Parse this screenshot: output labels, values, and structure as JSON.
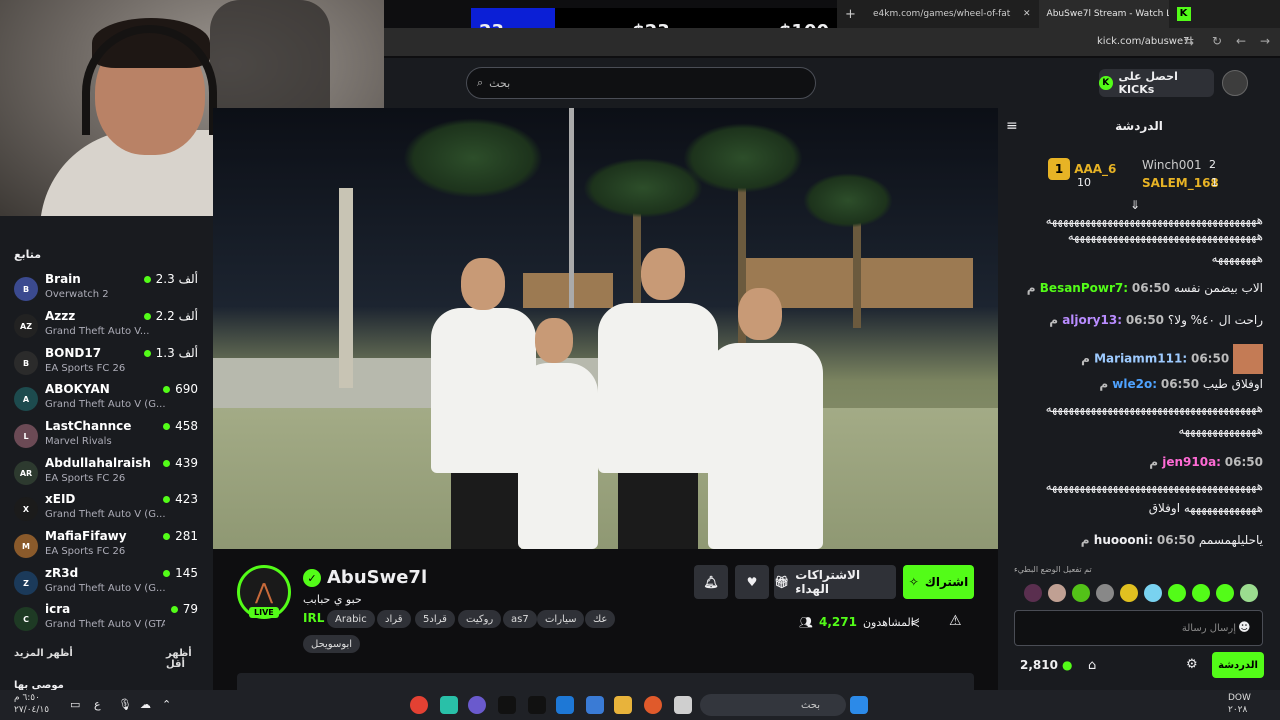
{
  "overlay": {
    "wheel": {
      "left": "23",
      "middle": "$23",
      "right": "$100"
    }
  },
  "browser": {
    "tabs": [
      "e4km.com/games/wheel-of-fat",
      "AbuSwe7l Stream - Watch L"
    ],
    "new_tab": "+",
    "url": "kick.com/abuswe7l"
  },
  "header": {
    "search_placeholder": "بحث",
    "get_kicks": "احصل على KICKs"
  },
  "sidebar": {
    "title": "متابع",
    "channels": [
      {
        "name": "Brain",
        "game": "Overwatch 2",
        "viewers": "2.3 ألف",
        "color": "#3b4a8f",
        "initial": "B"
      },
      {
        "name": "Azzz",
        "game": "Grand Theft Auto V...",
        "viewers": "2.2 ألف",
        "color": "#222222",
        "initial": "AZ"
      },
      {
        "name": "BOND17",
        "game": "EA Sports FC 26",
        "viewers": "1.3 ألف",
        "color": "#2b2b2b",
        "initial": "B"
      },
      {
        "name": "ABOKYAN",
        "game": "Grand Theft Auto V (G...",
        "viewers": "690",
        "color": "#1d4b4e",
        "initial": "A"
      },
      {
        "name": "LastChannce",
        "game": "Marvel Rivals",
        "viewers": "458",
        "color": "#6b4a55",
        "initial": "L"
      },
      {
        "name": "Abdullahalraish",
        "game": "EA Sports FC 26",
        "viewers": "439",
        "color": "#2d3a2f",
        "initial": "AR"
      },
      {
        "name": "xEID",
        "game": "Grand Theft Auto V (G...",
        "viewers": "423",
        "color": "#1b1b1b",
        "initial": "X"
      },
      {
        "name": "MafiaFifawy",
        "game": "EA Sports FC 26",
        "viewers": "281",
        "color": "#8a5a2b",
        "initial": "M"
      },
      {
        "name": "zR3d",
        "game": "Grand Theft Auto V (G...",
        "viewers": "145",
        "color": "#1b3a5a",
        "initial": "Z"
      },
      {
        "name": "icra",
        "game": "Grand Theft Auto V (GTA)",
        "viewers": "79",
        "color": "#1e3a24",
        "initial": "C"
      }
    ],
    "show_more": "أظهر المزيد",
    "show_less": "أظهر أقل",
    "recommended": "موصى بها"
  },
  "channel": {
    "name": "AbuSwe7l",
    "live": "LIVE",
    "title": "حبو ي حبابب",
    "category": "IRL",
    "tags": [
      "Arabic",
      "قراد",
      "قراد5",
      "روكيت",
      "as7",
      "سيارات",
      "عك",
      "ابوسويحل"
    ],
    "subscribe": "اشتراك",
    "gift_subs": "الاشتراكات الهداء",
    "viewers_label": "المشاهدون",
    "viewers": "4,271"
  },
  "chat": {
    "title": "الدردشة",
    "leaderboard": [
      {
        "name": "AAA_6",
        "count": "10",
        "rank": "1"
      },
      {
        "name": "Winch001",
        "count": "2",
        "rank": "2"
      },
      {
        "name": "SALEM_168",
        "count": "1",
        "rank": "3"
      }
    ],
    "messages": [
      {
        "time": "",
        "user": "",
        "text": "ههههههههههههههههههههههههههههههههههههههه",
        "color": "#ffffff"
      },
      {
        "time": "",
        "user": "",
        "text": "ههههههههههههههههههههههههههههههههههه",
        "color": "#ffffff"
      },
      {
        "time": "",
        "user": "",
        "text": "ههههههههه",
        "color": "#ffffff"
      },
      {
        "time": "06:50 م",
        "user": "BesanPowr7:",
        "text": "الاب بيضمن نفسه",
        "color": "#53fc18"
      },
      {
        "time": "06:50 م",
        "user": "aljory13:",
        "text": "راحت ال ٤٠% ولا؟",
        "color": "#b98cff"
      },
      {
        "time": "06:50 م",
        "user": "Mariamm111:",
        "text": "",
        "color": "#9ecbff"
      },
      {
        "time": "06:50 م",
        "user": "wle2o:",
        "text": "اوفلاق طيب",
        "color": "#4fa3ff"
      },
      {
        "time": "",
        "user": "",
        "text": "ههههههههههههههههههههههههههههههههههههههه",
        "color": "#ffffff"
      },
      {
        "time": "",
        "user": "",
        "text": "ههههههههههههههه",
        "color": "#ffffff"
      },
      {
        "time": "06:50 م",
        "user": "jen910a:",
        "text": "",
        "color": "#ff6bd5"
      },
      {
        "time": "",
        "user": "",
        "text": "ههههههههههههههههههههههههههههههههههههههه",
        "color": "#ffffff"
      },
      {
        "time": "",
        "user": "",
        "text": "هههههههههههههه اوفلاق",
        "color": "#ffffff"
      },
      {
        "time": "06:50 م",
        "user": "huoooni:",
        "text": "ياحليلهمسمم",
        "color": "#ffffff"
      }
    ],
    "paused_note": "تم تفعيل الوضع البطيء",
    "input_placeholder": "إرسال رسالة",
    "send": "الدردشة",
    "points": "2,810"
  },
  "taskbar": {
    "search": "بحث",
    "clock_time": "٦:٥٠ م",
    "clock_date": "٢٧/٠٤/١٥",
    "lang_top": "DOW",
    "lang_bottom": "٢٠٢٨",
    "input_lang": "ع"
  }
}
